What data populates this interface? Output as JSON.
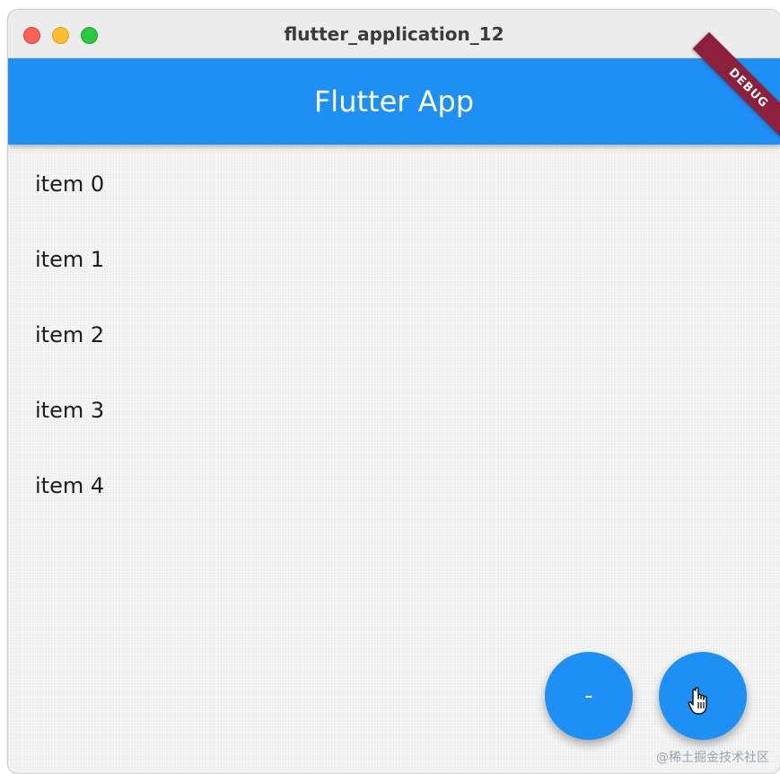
{
  "window": {
    "title": "flutter_application_12"
  },
  "appbar": {
    "title": "Flutter App",
    "debug_banner": "DEBUG"
  },
  "list": {
    "items": [
      {
        "label": "item 0"
      },
      {
        "label": "item 1"
      },
      {
        "label": "item 2"
      },
      {
        "label": "item 3"
      },
      {
        "label": "item 4"
      }
    ]
  },
  "fabs": {
    "minus_label": "-",
    "plus_icon": "hand-pointer-cursor-icon"
  },
  "watermark": "@稀土掘金技术社区",
  "colors": {
    "primary": "#1e90f5",
    "debug_banner": "#8b1f3c",
    "background": "#f5f5f5"
  }
}
